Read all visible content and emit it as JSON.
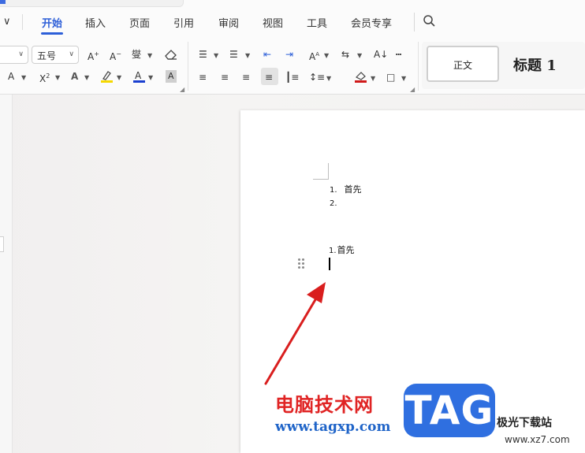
{
  "menubar": {
    "tabs": [
      {
        "label": "开始",
        "active": true
      },
      {
        "label": "插入"
      },
      {
        "label": "页面"
      },
      {
        "label": "引用"
      },
      {
        "label": "审阅"
      },
      {
        "label": "视图"
      },
      {
        "label": "工具"
      },
      {
        "label": "会员专享"
      }
    ],
    "icons": [
      "chevron-down-icon",
      "search-icon"
    ]
  },
  "ribbon": {
    "font_size": "五号",
    "font_name": "",
    "styles": {
      "normal": "正文",
      "heading1": "标题 1"
    },
    "highlight_color": "#f5d800",
    "font_color": "#d01a1a",
    "accent_color": "#2d5fd8"
  },
  "document": {
    "list1": [
      {
        "number": "1.",
        "text": "首先"
      },
      {
        "number": "2.",
        "text": ""
      }
    ],
    "list2_item": {
      "number": "1.",
      "text": "首先"
    }
  },
  "watermark": {
    "site_name": "电脑技术网",
    "site_url": "www.tagxp.com",
    "logo_text": "TAG",
    "partner_name": "极光下载站",
    "partner_url": "www.xz7.com"
  },
  "colors": {
    "arrow": "#d91e1e",
    "page_bg": "#ffffff",
    "workspace_bg": "#f3f2f1"
  }
}
